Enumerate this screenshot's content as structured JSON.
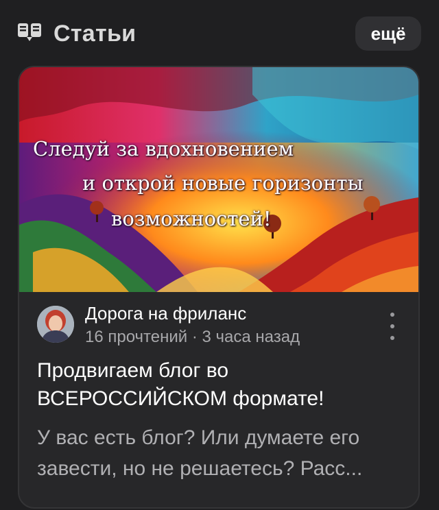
{
  "header": {
    "icon": "zen-articles-icon",
    "title": "Статьи",
    "more_label": "ещё"
  },
  "article": {
    "cover": {
      "lines": [
        "Следуй за вдохновением",
        "и открой новые горизонты",
        "возможностей!"
      ]
    },
    "channel_name": "Дорога на фриланс",
    "stats": "16 прочтений · 3 часа назад",
    "title": "Продвигаем блог во ВСЕРОССИЙСКОМ формате!",
    "snippet": "У вас есть блог? Или думаете его завести, но не решаетесь? Расс...",
    "menu_icon": "kebab-menu-icon"
  },
  "colors": {
    "background": "#1f1f21",
    "card": "#272729",
    "button": "#303033",
    "secondary_text": "#a8a8ab"
  }
}
